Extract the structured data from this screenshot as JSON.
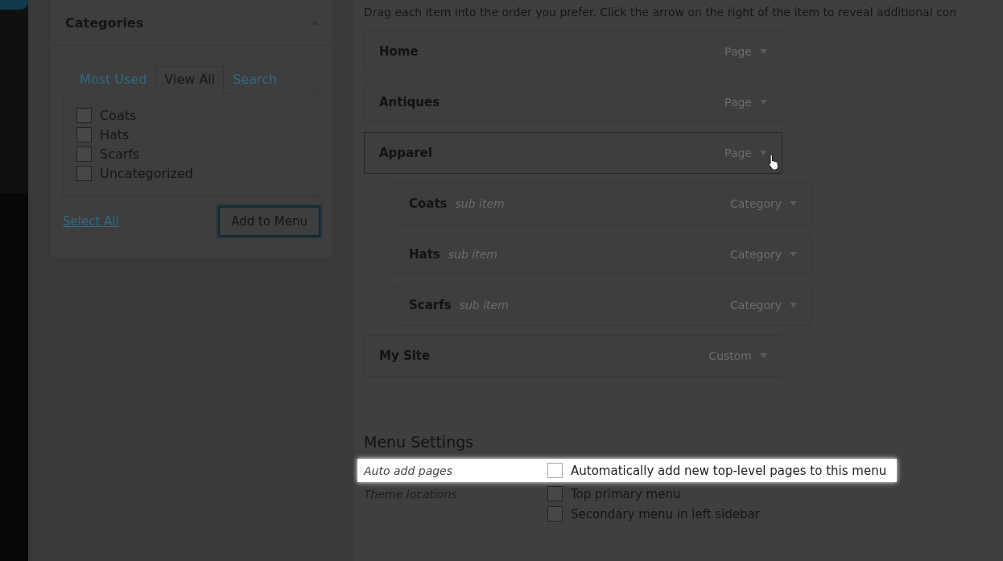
{
  "categories": {
    "title": "Categories",
    "tabs": [
      {
        "label": "Most Used",
        "selected": false
      },
      {
        "label": "View All",
        "selected": true
      },
      {
        "label": "Search",
        "selected": false
      }
    ],
    "items": [
      {
        "label": "Coats",
        "checked": false
      },
      {
        "label": "Hats",
        "checked": false
      },
      {
        "label": "Scarfs",
        "checked": false
      },
      {
        "label": "Uncategorized",
        "checked": false
      }
    ],
    "select_all": "Select All",
    "add_button": "Add to Menu"
  },
  "instructions": "Drag each item into the order you prefer. Click the arrow on the right of the item to reveal additional con",
  "menu_items": [
    {
      "title": "Home",
      "type": "Page",
      "hovered": false
    },
    {
      "title": "Antiques",
      "type": "Page",
      "hovered": false
    },
    {
      "title": "Apparel",
      "type": "Page",
      "hovered": true,
      "children": [
        {
          "title": "Coats",
          "note": "sub item",
          "type": "Category",
          "hovered": false
        },
        {
          "title": "Hats",
          "note": "sub item",
          "type": "Category",
          "hovered": false
        },
        {
          "title": "Scarfs",
          "note": "sub item",
          "type": "Category",
          "hovered": false
        }
      ]
    },
    {
      "title": "My Site",
      "type": "Custom",
      "hovered": false
    }
  ],
  "menu_settings": {
    "title": "Menu Settings",
    "rows": [
      {
        "label": "Auto add pages",
        "highlighted": true,
        "options": [
          {
            "label": "Automatically add new top-level pages to this menu",
            "checked": false
          }
        ]
      },
      {
        "label": "Theme locations",
        "highlighted": false,
        "options": [
          {
            "label": "Top primary menu",
            "checked": false
          },
          {
            "label": "Secondary menu in left sidebar",
            "checked": false
          }
        ]
      }
    ]
  }
}
